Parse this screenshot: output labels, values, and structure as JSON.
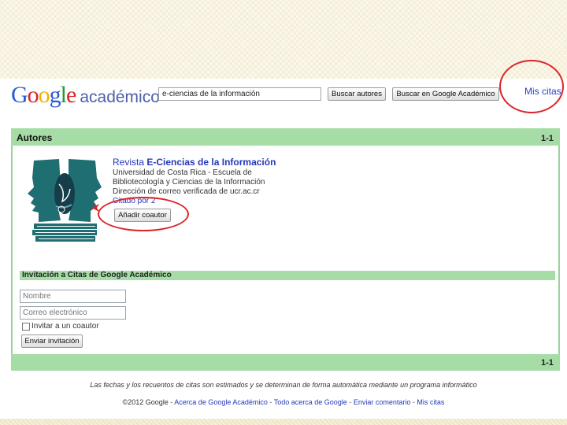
{
  "header": {
    "logo_letters": [
      "G",
      "o",
      "o",
      "g",
      "l",
      "e"
    ],
    "logo_colors": [
      "#2a5bd7",
      "#d9262a",
      "#f2b100",
      "#2a5bd7",
      "#1e9a3a",
      "#d9262a"
    ],
    "logo_word": "académico",
    "search_value": "e-ciencias de la información",
    "search_authors_label": "Buscar autores",
    "search_scholar_label": "Buscar en Google Académico",
    "my_citations_label": "Mis citas"
  },
  "panel": {
    "title": "Autores",
    "range_top": "1-1",
    "range_bottom": "1-1"
  },
  "author": {
    "name_prefix": "Revista ",
    "name_bold": "E-Ciencias de la Información",
    "lines": [
      "Universidad de Costa Rica - Escuela de",
      "Bibliotecología y Ciencias de la Información",
      "Dirección de correo verificada de ucr.ac.cr"
    ],
    "cited_by": "Citado por 2",
    "add_coauthor_label": "Añadir coautor"
  },
  "invitation": {
    "title": "Invitación a Citas de Google Académico",
    "name_placeholder": "Nombre",
    "email_placeholder": "Correo electrónico",
    "invite_checkbox_label": "Invitar a un coautor",
    "send_label": "Enviar invitación"
  },
  "footer": {
    "note": "Las fechas y los recuentos de citas son estimados y se determinan de forma automática mediante un programa informático",
    "copyright": "©2012 Google",
    "links": [
      "Acerca de Google Académico",
      "Todo acerca de Google",
      "Enviar comentario",
      "Mis citas"
    ]
  },
  "colors": {
    "accent_green": "#a6dca6",
    "link_blue": "#2438b8",
    "annotation_red": "#d9262a"
  }
}
